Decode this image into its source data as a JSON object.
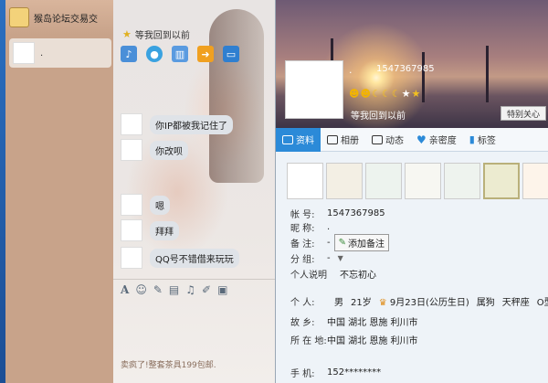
{
  "chat": {
    "title": "猴岛论坛交易交",
    "session_label": ".",
    "signature": "等我回到以前",
    "messages": [
      {
        "text": "你IP都被我记住了"
      },
      {
        "text": "你改呗"
      },
      {
        "text": "嗯"
      },
      {
        "text": "拜拜"
      },
      {
        "text": "QQ号不错借来玩玩"
      }
    ],
    "bottom_ad": "卖疯了!整套茶具199包邮.",
    "toolbar_icons": [
      "mic-icon",
      "video-icon",
      "chart-icon",
      "transfer-icon",
      "screen-share-icon"
    ],
    "input_tools": [
      "font-icon",
      "emoji-icon",
      "magic-icon",
      "film-icon",
      "voice-icon",
      "edit-icon",
      "image-icon"
    ]
  },
  "profile": {
    "nickname": ".",
    "qq_number": "1547367985",
    "level_icons": [
      "☻",
      "☻",
      "☾",
      "☾",
      "☾",
      "★",
      "★"
    ],
    "status": "等我回到以前",
    "care_button": "特别关心",
    "tabs": [
      {
        "label": "资料",
        "active": true
      },
      {
        "label": "相册",
        "active": false
      },
      {
        "label": "动态",
        "active": false
      },
      {
        "label": "亲密度",
        "active": false
      },
      {
        "label": "标签",
        "active": false
      }
    ],
    "account_label": "帐    号:",
    "account_value": "1547367985",
    "nick_label": "昵    称:",
    "nick_value": ".",
    "remark_label": "备    注:",
    "remark_value": "-",
    "remark_button": "添加备注",
    "group_label": "分    组:",
    "group_value": "-",
    "motto_label": "个人说明",
    "motto_value": "不忘初心",
    "personal_label": "个    人:",
    "gender": "男",
    "age": "21岁",
    "birthday": "9月23日(公历生日)",
    "zodiac": "属狗",
    "constellation": "天秤座",
    "blood": "O型",
    "hometown_label": "故    乡:",
    "hometown_value": "中国 湖北 恩施 利川市",
    "location_label": "所 在 地:",
    "location_value": "中国 湖北 恩施 利川市",
    "phone_label": "手    机:",
    "phone_value": "152********"
  },
  "colors": {
    "accent": "#2b8ad8",
    "chat_side": "#c8a38a",
    "desktop": "#1e5fa8"
  }
}
